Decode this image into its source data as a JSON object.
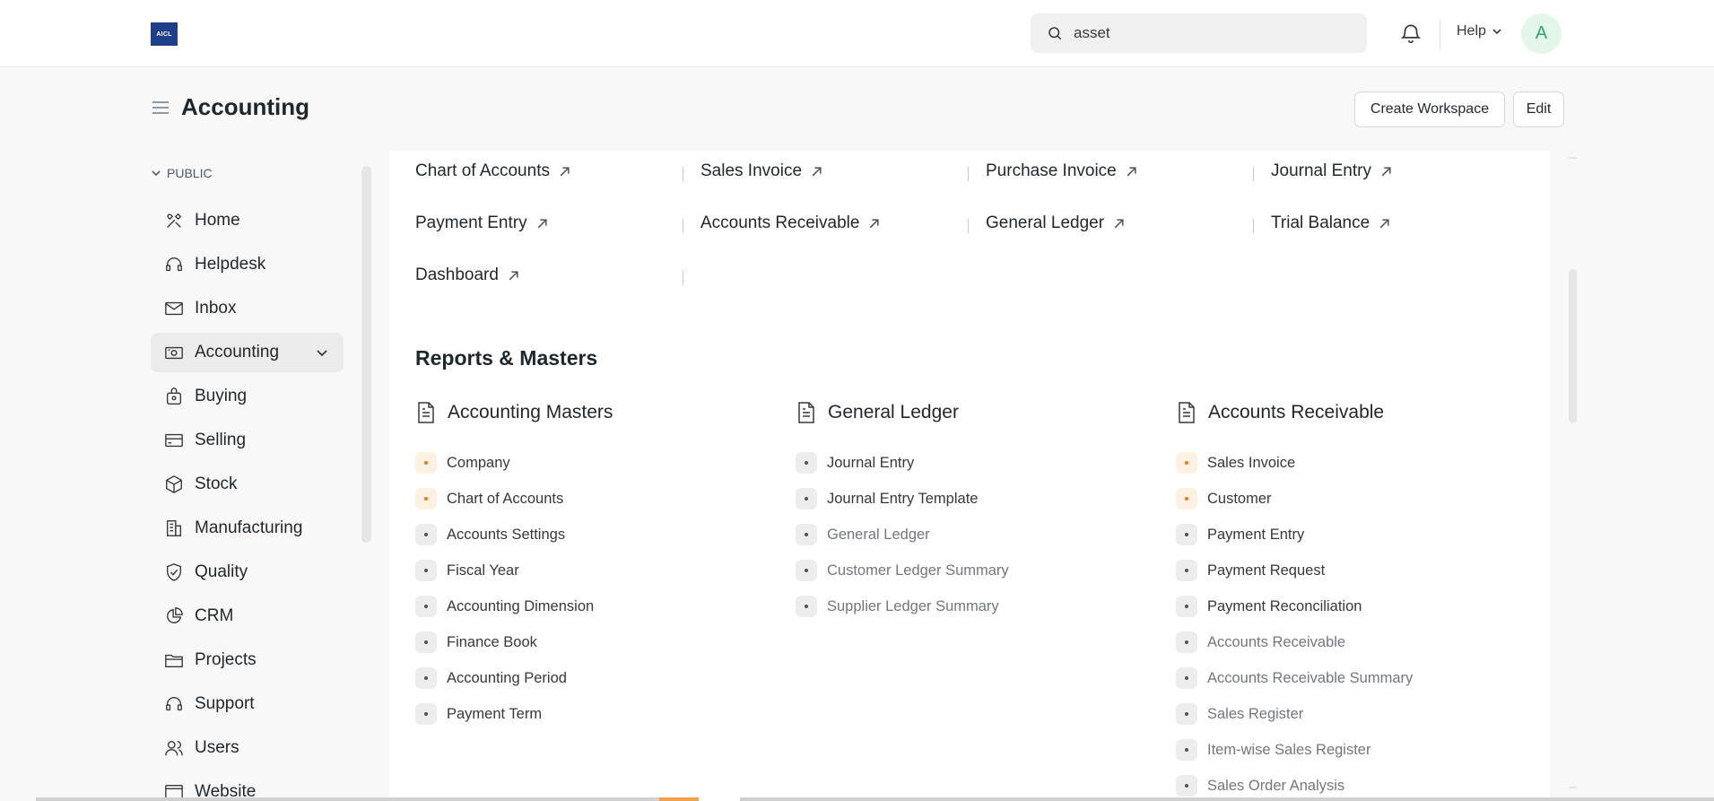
{
  "app": {
    "logo_text": "AICL",
    "search_value": "asset",
    "help_label": "Help",
    "avatar_initial": "A"
  },
  "header": {
    "title": "Accounting",
    "create_workspace_label": "Create Workspace",
    "edit_label": "Edit"
  },
  "sidebar": {
    "section_label": "PUBLIC",
    "items": [
      {
        "label": "Home",
        "icon": "tools-icon"
      },
      {
        "label": "Helpdesk",
        "icon": "headset-icon"
      },
      {
        "label": "Inbox",
        "icon": "mail-icon"
      },
      {
        "label": "Accounting",
        "icon": "money-icon",
        "active": true
      },
      {
        "label": "Buying",
        "icon": "bag-icon"
      },
      {
        "label": "Selling",
        "icon": "card-icon"
      },
      {
        "label": "Stock",
        "icon": "box-icon"
      },
      {
        "label": "Manufacturing",
        "icon": "building-icon"
      },
      {
        "label": "Quality",
        "icon": "shield-check-icon"
      },
      {
        "label": "CRM",
        "icon": "pie-chart-icon"
      },
      {
        "label": "Projects",
        "icon": "folder-icon"
      },
      {
        "label": "Support",
        "icon": "headset-icon"
      },
      {
        "label": "Users",
        "icon": "users-icon"
      },
      {
        "label": "Website",
        "icon": "browser-icon"
      }
    ]
  },
  "shortcuts": [
    {
      "label": "Chart of Accounts"
    },
    {
      "label": "Sales Invoice"
    },
    {
      "label": "Purchase Invoice"
    },
    {
      "label": "Journal Entry"
    },
    {
      "label": "Payment Entry"
    },
    {
      "label": "Accounts Receivable"
    },
    {
      "label": "General Ledger"
    },
    {
      "label": "Trial Balance"
    },
    {
      "label": "Dashboard"
    }
  ],
  "reports_section": {
    "title": "Reports & Masters",
    "cards": [
      {
        "title": "Accounting Masters",
        "links": [
          {
            "label": "Company",
            "onboard": true,
            "muted": false
          },
          {
            "label": "Chart of Accounts",
            "onboard": true,
            "muted": false
          },
          {
            "label": "Accounts Settings",
            "onboard": false,
            "muted": false
          },
          {
            "label": "Fiscal Year",
            "onboard": false,
            "muted": false
          },
          {
            "label": "Accounting Dimension",
            "onboard": false,
            "muted": false
          },
          {
            "label": "Finance Book",
            "onboard": false,
            "muted": false
          },
          {
            "label": "Accounting Period",
            "onboard": false,
            "muted": false
          },
          {
            "label": "Payment Term",
            "onboard": false,
            "muted": false
          }
        ]
      },
      {
        "title": "General Ledger",
        "links": [
          {
            "label": "Journal Entry",
            "onboard": false,
            "muted": false
          },
          {
            "label": "Journal Entry Template",
            "onboard": false,
            "muted": false
          },
          {
            "label": "General Ledger",
            "onboard": false,
            "muted": true
          },
          {
            "label": "Customer Ledger Summary",
            "onboard": false,
            "muted": true
          },
          {
            "label": "Supplier Ledger Summary",
            "onboard": false,
            "muted": true
          }
        ]
      },
      {
        "title": "Accounts Receivable",
        "links": [
          {
            "label": "Sales Invoice",
            "onboard": true,
            "muted": false
          },
          {
            "label": "Customer",
            "onboard": true,
            "muted": false
          },
          {
            "label": "Payment Entry",
            "onboard": false,
            "muted": false
          },
          {
            "label": "Payment Request",
            "onboard": false,
            "muted": false
          },
          {
            "label": "Payment Reconciliation",
            "onboard": false,
            "muted": false
          },
          {
            "label": "Accounts Receivable",
            "onboard": false,
            "muted": true
          },
          {
            "label": "Accounts Receivable Summary",
            "onboard": false,
            "muted": true
          },
          {
            "label": "Sales Register",
            "onboard": false,
            "muted": true
          },
          {
            "label": "Item-wise Sales Register",
            "onboard": false,
            "muted": true
          },
          {
            "label": "Sales Order Analysis",
            "onboard": false,
            "muted": true
          }
        ]
      }
    ]
  },
  "colors": {
    "accent_orange": "#e57d22",
    "avatar_green": "#30a66d",
    "logo_blue": "#1f3f8a"
  }
}
